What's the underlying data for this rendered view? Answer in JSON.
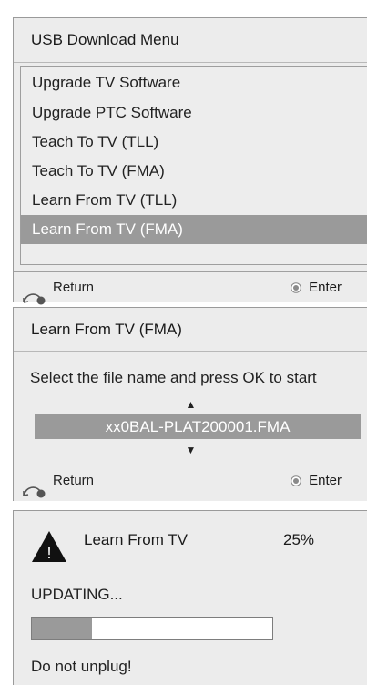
{
  "usb_menu": {
    "title": "USB Download Menu",
    "items": [
      {
        "label": "Upgrade TV Software"
      },
      {
        "label": "Upgrade PTC Software"
      },
      {
        "label": "Teach To TV (TLL)"
      },
      {
        "label": "Teach To TV (FMA)"
      },
      {
        "label": "Learn From TV (TLL)"
      },
      {
        "label": "Learn From TV (FMA)"
      }
    ],
    "selected_index": 5,
    "footer": {
      "return_label": "Return",
      "enter_label": "Enter"
    }
  },
  "file_dialog": {
    "title": "Learn From TV (FMA)",
    "instruction": "Select the file name and press OK to start",
    "up_arrow": "▲",
    "down_arrow": "▼",
    "filename": "xx0BAL-PLAT200001.FMA",
    "footer": {
      "return_label": "Return",
      "enter_label": "Enter"
    }
  },
  "progress_dialog": {
    "title": "Learn From TV",
    "percent_label": "25%",
    "progress_fraction": 0.25,
    "status": "UPDATING...",
    "warning": "Do not unplug!",
    "warning_icon_glyph": "!"
  },
  "colors": {
    "panel_bg": "#ececec",
    "selection_bg": "#9a9a9a",
    "selection_text": "#ffffff",
    "progress_fill": "#9a9a9a"
  },
  "icons": {
    "return": "return-arrow-icon",
    "enter": "ok-button-icon",
    "warning": "warning-triangle-icon"
  }
}
